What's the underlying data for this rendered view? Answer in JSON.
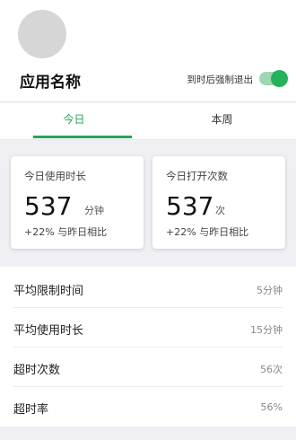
{
  "header": {
    "app_name": "应用名称",
    "force_exit_label": "到时后强制退出",
    "force_exit_enabled": true
  },
  "tabs": [
    {
      "label": "今日",
      "active": true
    },
    {
      "label": "本周",
      "active": false
    }
  ],
  "stats": {
    "usage": {
      "title": "今日使用时长",
      "value": "537",
      "unit": "分钟",
      "delta": "+22% 与昨日相比"
    },
    "opens": {
      "title": "今日打开次数",
      "value": "537",
      "unit": "次",
      "delta": "+22% 与昨日相比"
    }
  },
  "details": [
    {
      "label": "平均限制时间",
      "value": "5分钟"
    },
    {
      "label": "平均使用时长",
      "value": "15分钟"
    },
    {
      "label": "超时次数",
      "value": "56次"
    },
    {
      "label": "超时率",
      "value": "56%"
    }
  ],
  "colors": {
    "accent": "#23a55a",
    "toggle_track": "#9ed6b1"
  }
}
